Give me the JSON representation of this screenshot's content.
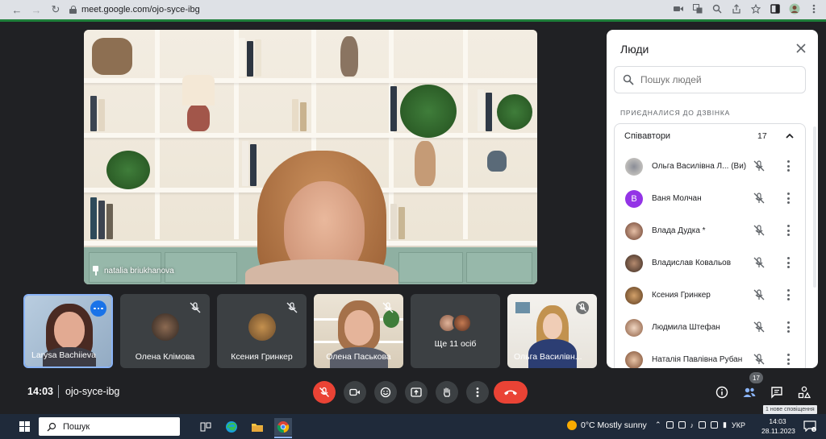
{
  "browser": {
    "url": "meet.google.com/ojo-syce-ibg"
  },
  "main_video": {
    "speaker_name": "natalia briukhanova"
  },
  "tiles": [
    {
      "name": "Larysa Bachiieva"
    },
    {
      "name": "Олена Клімова"
    },
    {
      "name": "Ксения Гринкер"
    },
    {
      "name": "Олена Паськова"
    },
    {
      "name": "Ще 11 осіб"
    },
    {
      "name": "Ольга Василівн..."
    }
  ],
  "panel": {
    "title": "Люди",
    "search_placeholder": "Пошук людей",
    "section_label": "ПРИЄДНАЛИСЯ ДО ДЗВІНКА",
    "group_name": "Співавтори",
    "group_count": "17",
    "people": [
      {
        "name": "Ольга Василівна Л... (Ви)",
        "avatar_letter": ""
      },
      {
        "name": "Ваня Молчан",
        "avatar_letter": "В"
      },
      {
        "name": "Влада Дудка *",
        "avatar_letter": ""
      },
      {
        "name": "Владислав Ковальов",
        "avatar_letter": ""
      },
      {
        "name": "Ксения Гринкер",
        "avatar_letter": ""
      },
      {
        "name": "Людмила Штефан",
        "avatar_letter": ""
      },
      {
        "name": "Наталія Павлівна Рубан",
        "avatar_letter": ""
      }
    ]
  },
  "bottom_bar": {
    "time": "14:03",
    "meeting_code": "ojo-syce-ibg",
    "people_count": "17",
    "tooltip": "1 нове сповіщення"
  },
  "taskbar": {
    "search_text": "Пошук",
    "weather": "0°C  Mostly sunny",
    "language": "УКР",
    "clock_time": "14:03",
    "clock_date": "28.11.2023"
  },
  "colors": {
    "accent_blue": "#1a73e8",
    "end_call_red": "#ea4335",
    "meet_bg": "#202124",
    "tile_bg": "#3c4043"
  }
}
